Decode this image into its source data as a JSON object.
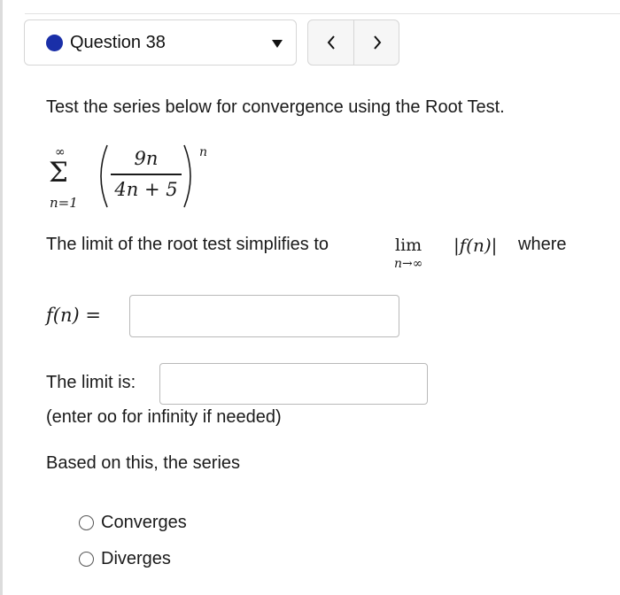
{
  "question_select": {
    "label": "Question 38"
  },
  "prompt": "Test the series below for convergence using the Root Test.",
  "series": {
    "sum_upper": "∞",
    "sum_lower": "n=1",
    "numerator": "9n",
    "denominator": "4n + 5",
    "exponent": "n"
  },
  "limit_line": {
    "text": "The limit of the root test simplifies to",
    "lim": "lim",
    "lim_sub": "n→∞",
    "abs_expr": "|f(n)|",
    "where": "where"
  },
  "fn_field": {
    "label": "f(n) =",
    "value": ""
  },
  "limit_field": {
    "label": "The limit is:",
    "value": "",
    "hint": "(enter oo for infinity if needed)"
  },
  "conclusion_prompt": "Based on this, the series",
  "options": [
    "Converges",
    "Diverges"
  ],
  "colors": {
    "dot": "#1a2fa8",
    "border": "#d6d6d6"
  }
}
